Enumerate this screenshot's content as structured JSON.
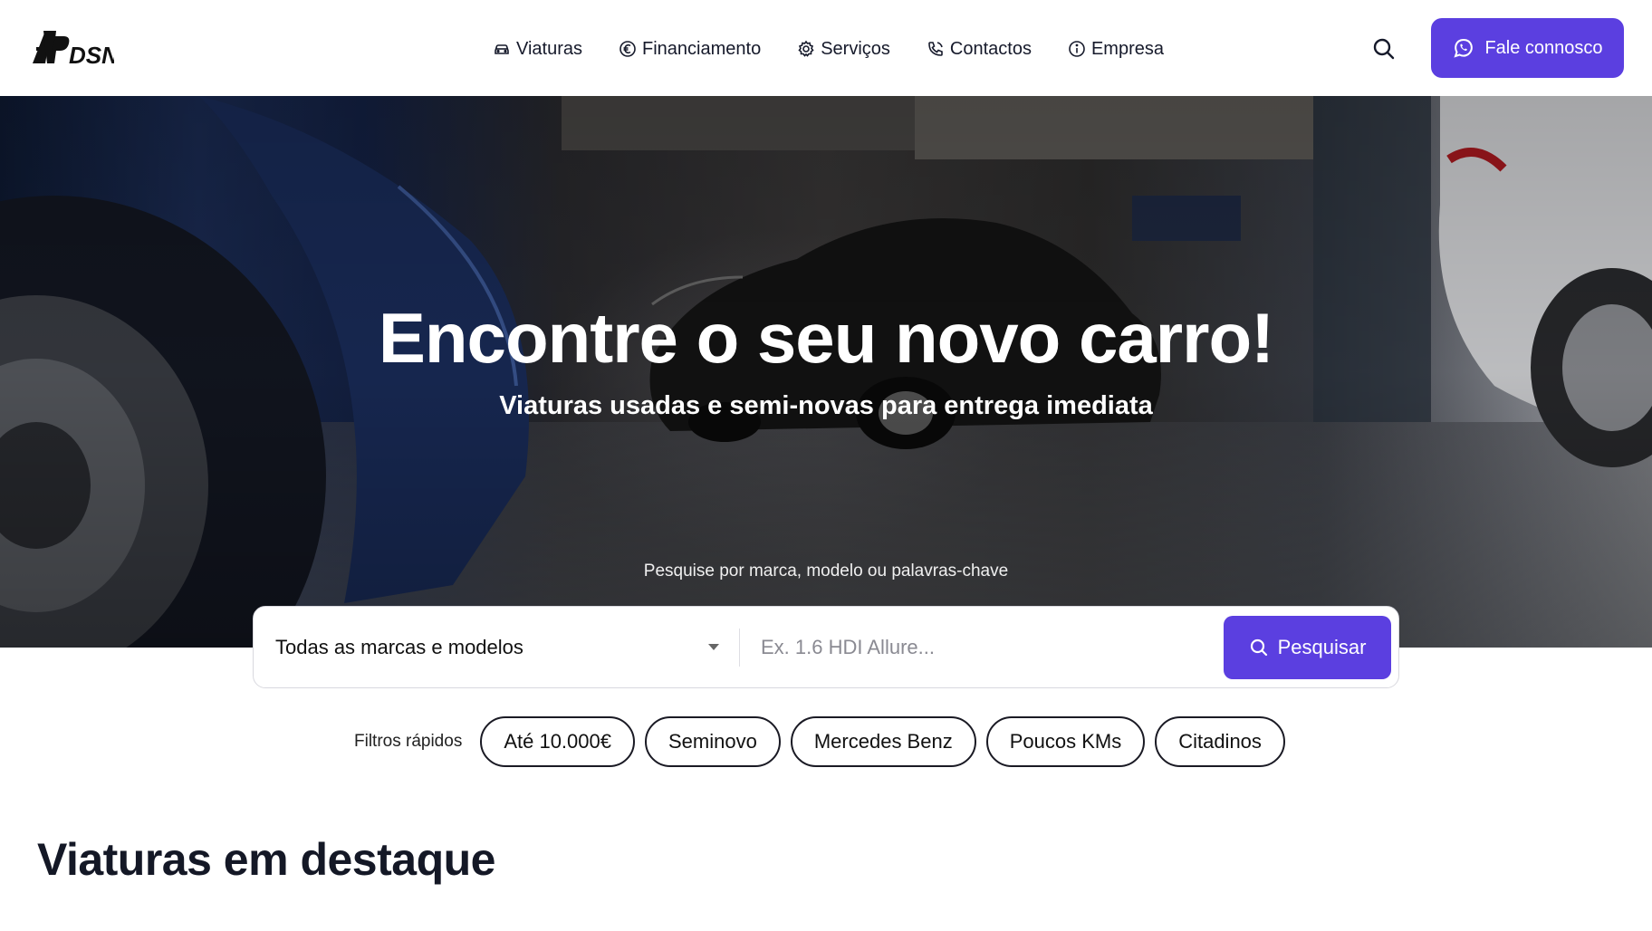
{
  "header": {
    "logo_text": "APDSN",
    "nav": [
      {
        "label": "Viaturas",
        "icon": "car-icon"
      },
      {
        "label": "Financiamento",
        "icon": "euro-icon"
      },
      {
        "label": "Serviços",
        "icon": "gear-icon"
      },
      {
        "label": "Contactos",
        "icon": "phone-icon"
      },
      {
        "label": "Empresa",
        "icon": "info-icon"
      }
    ],
    "search_icon": "search-icon",
    "cta_label": "Fale connosco",
    "cta_icon": "whatsapp-icon"
  },
  "hero": {
    "title": "Encontre o seu novo carro!",
    "subtitle": "Viaturas usadas e semi-novas para entrega imediata",
    "hint": "Pesquise por marca, modelo ou palavras-chave"
  },
  "search": {
    "select_value": "Todas as marcas e modelos",
    "placeholder": "Ex. 1.6 HDI Allure...",
    "button_label": "Pesquisar"
  },
  "quick_filters": {
    "label": "Filtros rápidos",
    "chips": [
      "Até 10.000€",
      "Seminovo",
      "Mercedes Benz",
      "Poucos KMs",
      "Citadinos"
    ]
  },
  "featured": {
    "title": "Viaturas em destaque"
  },
  "colors": {
    "accent": "#5b3fe0",
    "text": "#141826"
  }
}
